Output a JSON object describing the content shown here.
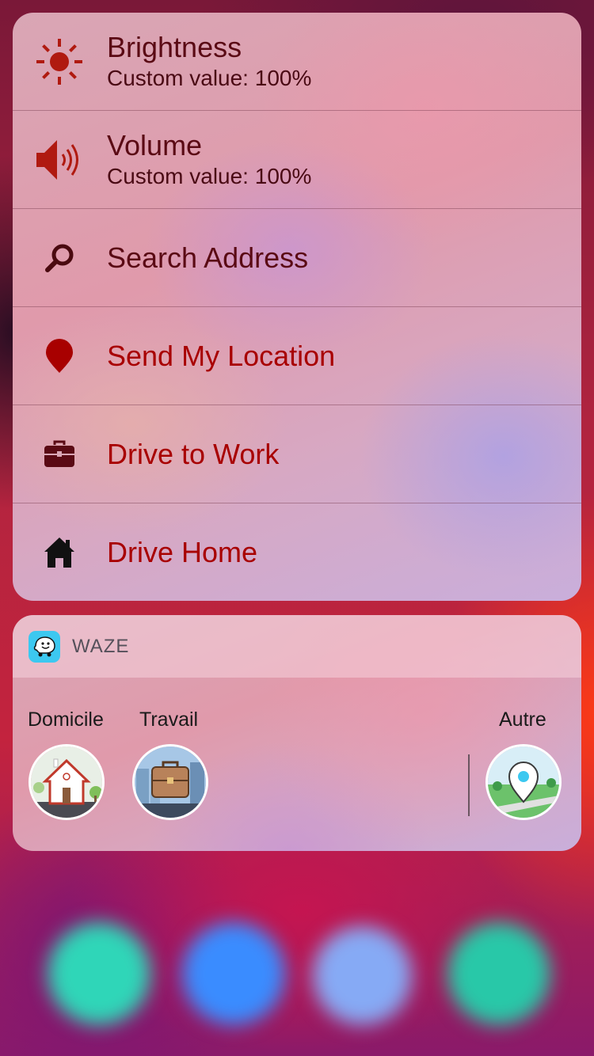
{
  "menu": {
    "brightness": {
      "title": "Brightness",
      "subtitle": "Custom value: 100%",
      "icon": "sun-icon"
    },
    "volume": {
      "title": "Volume",
      "subtitle": "Custom value: 100%",
      "icon": "speaker-icon"
    },
    "search": {
      "title": "Search Address",
      "icon": "search-icon"
    },
    "send_location": {
      "title": "Send My Location",
      "icon": "location-pin-icon"
    },
    "drive_work": {
      "title": "Drive to Work",
      "icon": "briefcase-icon"
    },
    "drive_home": {
      "title": "Drive Home",
      "icon": "house-icon"
    }
  },
  "widget": {
    "app_name": "WAZE",
    "destinations": [
      {
        "label": "Domicile",
        "icon": "home-illustration-icon"
      },
      {
        "label": "Travail",
        "icon": "work-illustration-icon"
      },
      {
        "label": "Autre",
        "icon": "other-pin-illustration-icon"
      }
    ]
  },
  "colors": {
    "dark_text": "#5a0a14",
    "red_text": "#a80000",
    "waze_blue": "#3cc8f0"
  }
}
